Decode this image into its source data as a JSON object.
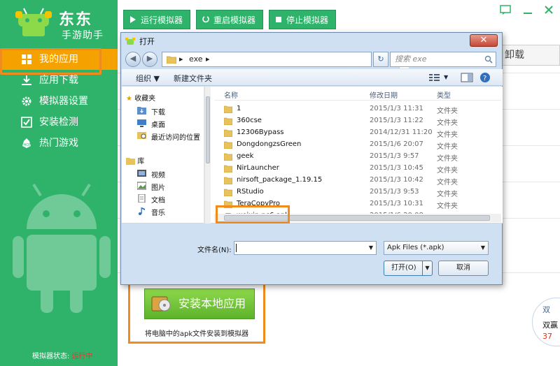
{
  "app": {
    "logo_line1": "东东",
    "logo_line2": "手游助手",
    "brand_color": "#2fb36a",
    "accent_color": "#f5a100",
    "highlight_color": "#f08c1e"
  },
  "sidebar": {
    "items": [
      {
        "label": "我的应用",
        "icon": "grid-icon",
        "active": true
      },
      {
        "label": "应用下载",
        "icon": "download-icon"
      },
      {
        "label": "模拟器设置",
        "icon": "gear-icon"
      },
      {
        "label": "安装检测",
        "icon": "check-icon"
      },
      {
        "label": "热门游戏",
        "icon": "hot-icon"
      }
    ],
    "status_label": "模拟器状态:",
    "status_value": "运行中"
  },
  "toolbar": {
    "run_label": "运行模拟器",
    "restart_label": "重启模拟器",
    "stop_label": "停止模拟器"
  },
  "background": {
    "partial_button_label": "卸载",
    "promo_line1": "双",
    "promo_line2": "双赢",
    "promo_line3": "37"
  },
  "install": {
    "button_label": "安装本地应用",
    "description": "将电脑中的apk文件安装到模拟器"
  },
  "dialog": {
    "title": "打开",
    "close_label": "✕",
    "address": {
      "segment": "exe"
    },
    "search_placeholder": "搜索 exe",
    "organize_label": "组织",
    "new_folder_label": "新建文件夹",
    "tree": {
      "favorites_label": "收藏夹",
      "favorites": [
        {
          "label": "下载",
          "icon": "download-folder-icon"
        },
        {
          "label": "桌面",
          "icon": "desktop-icon"
        },
        {
          "label": "最近访问的位置",
          "icon": "recent-places-icon"
        }
      ],
      "library_label": "库",
      "library": [
        {
          "label": "视频",
          "icon": "video-icon"
        },
        {
          "label": "图片",
          "icon": "picture-icon"
        },
        {
          "label": "文档",
          "icon": "document-icon"
        },
        {
          "label": "音乐",
          "icon": "music-icon"
        }
      ]
    },
    "columns": {
      "name": "名称",
      "date": "修改日期",
      "type": "类型"
    },
    "files": [
      {
        "name": "1",
        "date": "2015/1/3 11:31",
        "type": "文件夹",
        "kind": "folder"
      },
      {
        "name": "360cse",
        "date": "2015/1/3 11:22",
        "type": "文件夹",
        "kind": "folder"
      },
      {
        "name": "12306Bypass",
        "date": "2014/12/31 11:20",
        "type": "文件夹",
        "kind": "folder"
      },
      {
        "name": "DongdongzsGreen",
        "date": "2015/1/6 20:07",
        "type": "文件夹",
        "kind": "folder"
      },
      {
        "name": "geek",
        "date": "2015/1/3 9:57",
        "type": "文件夹",
        "kind": "folder"
      },
      {
        "name": "NirLauncher",
        "date": "2015/1/3 10:45",
        "type": "文件夹",
        "kind": "folder"
      },
      {
        "name": "nirsoft_package_1.19.15",
        "date": "2015/1/3 10:42",
        "type": "文件夹",
        "kind": "folder"
      },
      {
        "name": "RStudio",
        "date": "2015/1/3 9:53",
        "type": "文件夹",
        "kind": "folder"
      },
      {
        "name": "TeraCopyPro",
        "date": "2015/1/3 10:31",
        "type": "文件夹",
        "kind": "folder"
      },
      {
        "name": "weixin.pc6.apk",
        "date": "2015/1/6 20:08",
        "type": "APK 文件",
        "kind": "apk"
      }
    ],
    "filename_label": "文件名(N):",
    "filename_value": "",
    "filetype_value": "Apk Files (*.apk)",
    "open_label": "打开(O)",
    "cancel_label": "取消"
  }
}
